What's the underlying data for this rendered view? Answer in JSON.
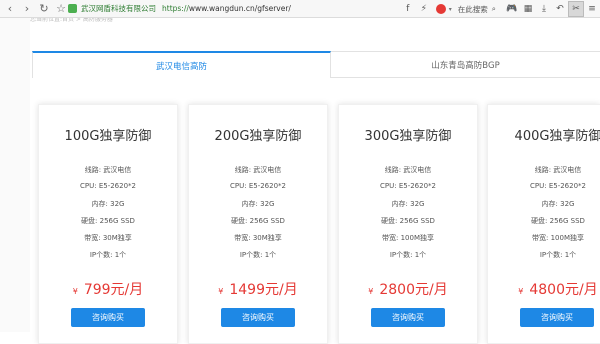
{
  "browser": {
    "back_icon": "back-icon",
    "forward_icon": "forward-icon",
    "reload_icon": "reload-icon",
    "star_icon": "star-icon",
    "site_name": "武汉网盾科技有限公司",
    "url_protocol": "https://",
    "url_rest": "www.wangdun.cn/gfserver/",
    "search_placeholder": "在此搜索",
    "accent_green": "#2e7d32"
  },
  "breadcrumb": "您当前位置:首页  > 高防服务器",
  "tabs": [
    {
      "label": "武汉电信高防",
      "active": true
    },
    {
      "label": "山东青岛高防BGP",
      "active": false
    }
  ],
  "spec_labels": {
    "line": "线路:",
    "cpu": "CPU:",
    "ram": "内存:",
    "disk": "硬盘:",
    "bw": "带宽:",
    "ip": "IP个数:"
  },
  "plans": [
    {
      "title": "100G独享防御",
      "line": "武汉电信",
      "cpu": "E5-2620*2",
      "ram": "32G",
      "disk": "256G SSD",
      "bw": "30M独享",
      "ip": "1个",
      "price": "799元/月",
      "button": "咨询购买"
    },
    {
      "title": "200G独享防御",
      "line": "武汉电信",
      "cpu": "E5-2620*2",
      "ram": "32G",
      "disk": "256G SSD",
      "bw": "30M独享",
      "ip": "1个",
      "price": "1499元/月",
      "button": "咨询购买"
    },
    {
      "title": "300G独享防御",
      "line": "武汉电信",
      "cpu": "E5-2620*2",
      "ram": "32G",
      "disk": "256G SSD",
      "bw": "100M独享",
      "ip": "1个",
      "price": "2800元/月",
      "button": "咨询购买"
    },
    {
      "title": "400G独享防御",
      "line": "武汉电信",
      "cpu": "E5-2620*2",
      "ram": "32G",
      "disk": "256G SSD",
      "bw": "100M独享",
      "ip": "1个",
      "price": "4800元/月",
      "button": "咨询购买"
    }
  ],
  "currency_symbol": "¥",
  "colors": {
    "accent_blue": "#1e88e5",
    "price_red": "#e53935"
  }
}
